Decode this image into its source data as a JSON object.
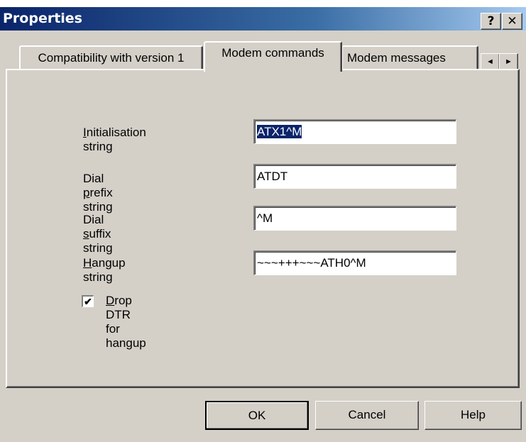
{
  "window": {
    "title": "Properties",
    "help_glyph": "?",
    "close_glyph": "✕"
  },
  "tabs": [
    {
      "label": "Compatibility with version 1"
    },
    {
      "label": "Modem commands"
    },
    {
      "label": "Modem messages"
    }
  ],
  "tab_scroll": {
    "left": "◄",
    "right": "►"
  },
  "fields": {
    "init": {
      "label_prefix": "",
      "label_accel": "I",
      "label_rest": "nitialisation string",
      "value": "ATX1^M"
    },
    "prefix": {
      "label_prefix": "Dial ",
      "label_accel": "p",
      "label_rest": "refix string",
      "value": "ATDT"
    },
    "suffix": {
      "label_prefix": "Dial ",
      "label_accel": "s",
      "label_rest": "uffix string",
      "value": "^M"
    },
    "hangup": {
      "label_prefix": "",
      "label_accel": "H",
      "label_rest": "angup string",
      "value": "~~~+++~~~ATH0^M"
    }
  },
  "checkbox": {
    "accel": "D",
    "rest": "rop DTR for hangup",
    "mark": "✔"
  },
  "buttons": {
    "ok": "OK",
    "cancel": "Cancel",
    "help": "Help"
  },
  "colors": {
    "title_start": "#0a246a",
    "title_end": "#a6caf0",
    "face": "#d4d0c8",
    "selection": "#0a246a"
  }
}
